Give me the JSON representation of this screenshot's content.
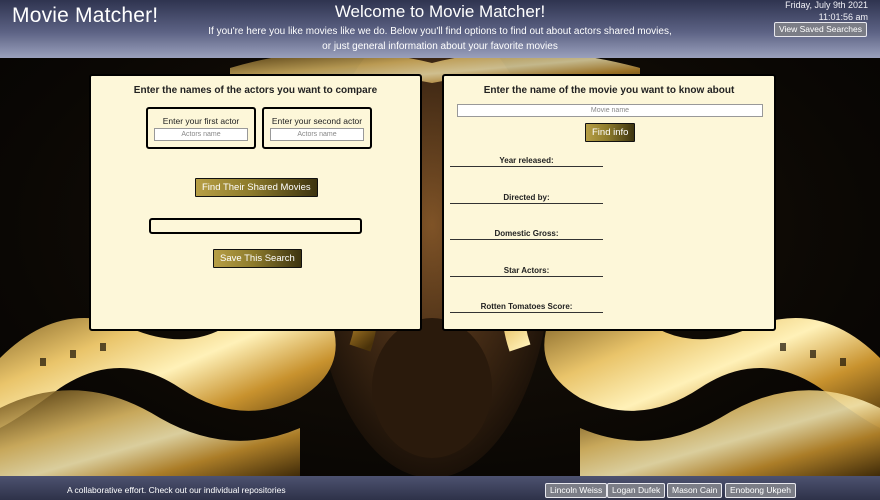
{
  "header": {
    "app_title": "Movie Matcher!",
    "welcome": "Welcome to Movie Matcher!",
    "intro_line1": "If you're here you like movies like we do. Below you'll find options to find out about actors shared movies,",
    "intro_line2": "or just general information about your favorite movies",
    "date": "Friday, July 9th 2021",
    "time": "11:01:56 am",
    "saved_searches_label": "View Saved Searches"
  },
  "compare_panel": {
    "heading": "Enter the names of the actors you want to compare",
    "first_actor_label": "Enter your first actor",
    "first_actor_placeholder": "Actors name",
    "second_actor_label": "Enter your second actor",
    "second_actor_placeholder": "Actors name",
    "find_button_label": "Find Their Shared Movies",
    "results_value": "",
    "save_button_label": "Save This Search"
  },
  "movie_panel": {
    "heading": "Enter the name of the movie you want to know about",
    "movie_placeholder": "Movie name",
    "find_info_label": "Find info",
    "fields": [
      "Year released:",
      "Directed by:",
      "Domestic Gross:",
      "Star Actors:",
      "Rotten Tomatoes Score:"
    ]
  },
  "footer": {
    "text": "A collaborative effort. Check out our individual repositories",
    "repos": [
      "Lincoln Weiss",
      "Logan Dufek",
      "Mason Cain",
      "Enobong Ukpeh"
    ]
  },
  "colors": {
    "header_dark": "#2f3450",
    "panel_bg": "#fdf7d9",
    "gold_button": "#b79f46"
  }
}
